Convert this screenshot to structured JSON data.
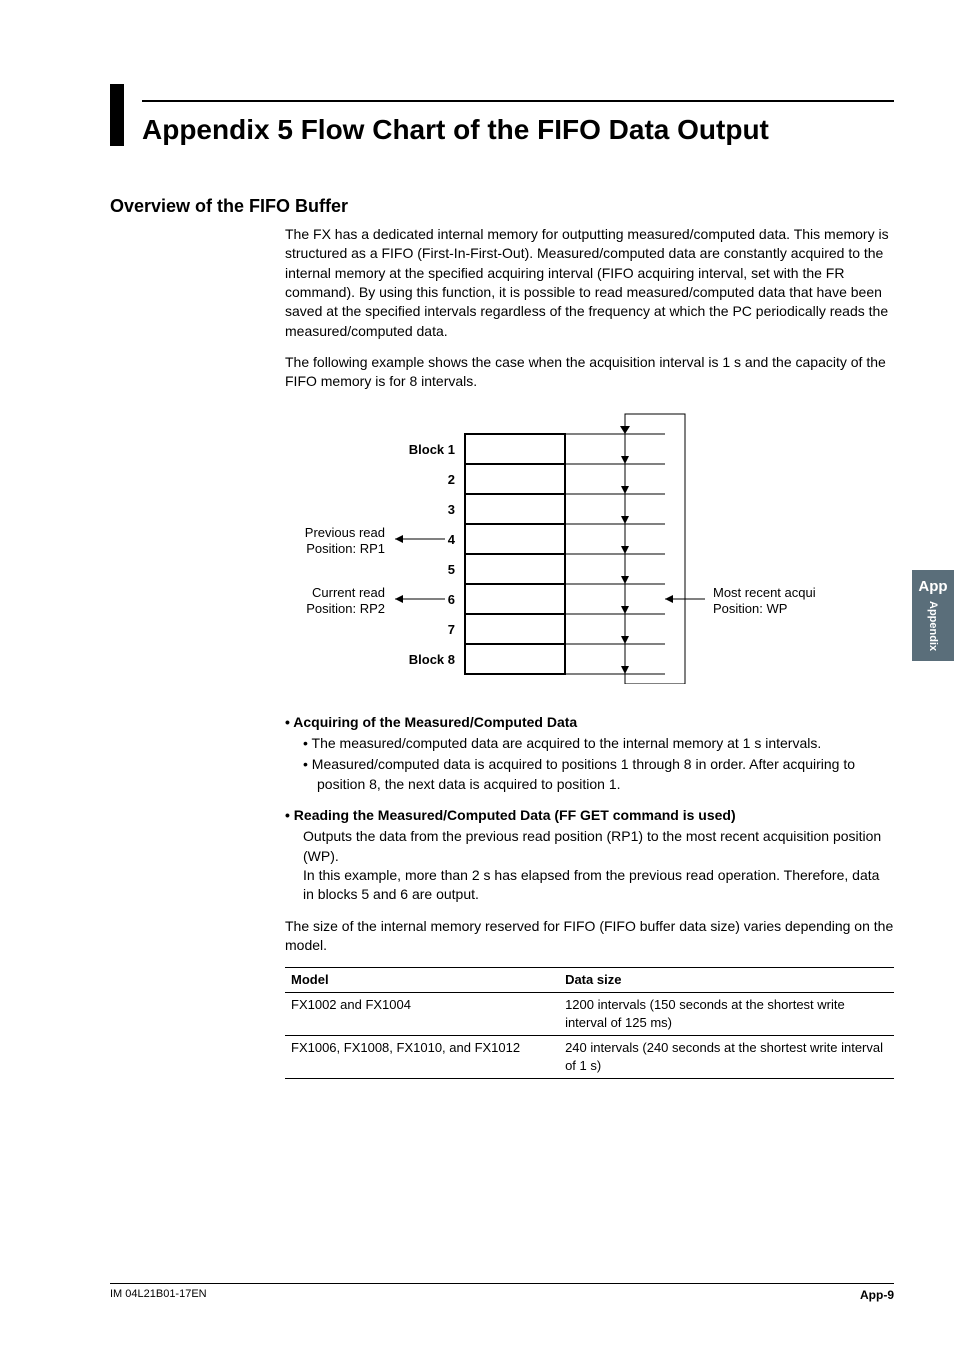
{
  "title": "Appendix 5   Flow Chart of the FIFO Data Output",
  "section_heading": "Overview of the FIFO Buffer",
  "para1": "The FX has a dedicated internal memory for outputting measured/computed data. This memory is structured as a FIFO (First-In-First-Out). Measured/computed data are constantly acquired to the internal memory at the specified acquiring interval (FIFO acquiring interval, set with the FR command). By using this function, it is possible to read measured/computed data that have been saved at the specified intervals regardless of the frequency at which the PC periodically reads the measured/computed data.",
  "para2": "The following example shows the case when the acquisition interval is 1 s and the capacity of the FIFO memory is for 8 intervals.",
  "diagram": {
    "block_label_first": "Block 1",
    "row2": "2",
    "row3": "3",
    "row4": "4",
    "row5": "5",
    "row6": "6",
    "row7": "7",
    "block_label_last": "Block 8",
    "prev_read_l1": "Previous read",
    "prev_read_l2": "Position: RP1",
    "curr_read_l1": "Current read",
    "curr_read_l2": "Position: RP2",
    "acquire_l1": "Most recent acquire",
    "acquire_l2": "Position: WP"
  },
  "bullet1": {
    "heading": "Acquiring of the Measured/Computed Data",
    "sub1": "The measured/computed data are acquired to the internal memory at 1 s intervals.",
    "sub2": "Measured/computed data is acquired to positions 1 through 8 in order. After acquiring to position 8, the next data is acquired to position 1."
  },
  "bullet2": {
    "heading": "Reading the Measured/Computed Data (FF GET command is used)",
    "line1": "Outputs the data from the previous read position (RP1) to the most recent acquisition position (WP).",
    "line2": "In this example, more than 2 s has elapsed from the previous read operation. Therefore, data in blocks 5 and 6 are output."
  },
  "table_intro": "The size of the internal memory reserved for FIFO (FIFO buffer data size) varies depending on the model.",
  "table": {
    "h_model": "Model",
    "h_size": "Data size",
    "r1_model": "FX1002 and FX1004",
    "r1_size": "1200 intervals (150 seconds at the shortest write interval of 125 ms)",
    "r2_model": "FX1006, FX1008, FX1010, and FX1012",
    "r2_size": "240 intervals (240 seconds at the shortest write interval of 1 s)"
  },
  "sidetab": {
    "label": "App",
    "sub": "Appendix"
  },
  "footer": {
    "doc_id": "IM 04L21B01-17EN",
    "page": "App-9"
  }
}
